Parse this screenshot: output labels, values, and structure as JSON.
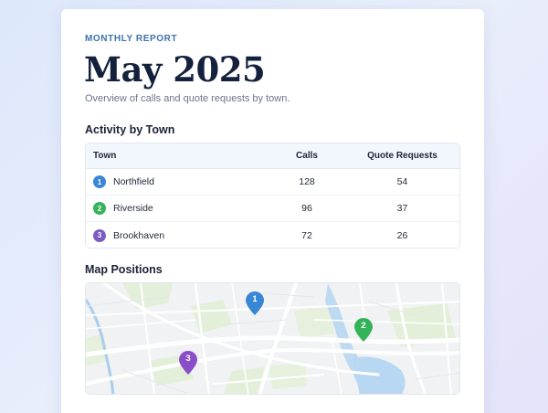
{
  "report": {
    "eyebrow": "MONTHLY REPORT",
    "title": "May 2025",
    "subtitle": "Overview of calls and quote requests by town."
  },
  "activity": {
    "heading": "Activity by Town",
    "columns": {
      "town": "Town",
      "calls": "Calls",
      "quotes": "Quote Requests"
    },
    "rows": [
      {
        "id": "1",
        "town": "Northfield",
        "calls": "128",
        "quotes": "54",
        "color": "#3a86d6"
      },
      {
        "id": "2",
        "town": "Riverside",
        "calls": "96",
        "quotes": "37",
        "color": "#35b35a"
      },
      {
        "id": "3",
        "town": "Brookhaven",
        "calls": "72",
        "quotes": "26",
        "color": "#7c5cc4"
      }
    ]
  },
  "map": {
    "heading": "Map Positions",
    "pins": [
      {
        "id": "1",
        "color": "#3a86d6"
      },
      {
        "id": "2",
        "color": "#35b35a"
      },
      {
        "id": "3",
        "color": "#8a4fc8"
      }
    ]
  }
}
